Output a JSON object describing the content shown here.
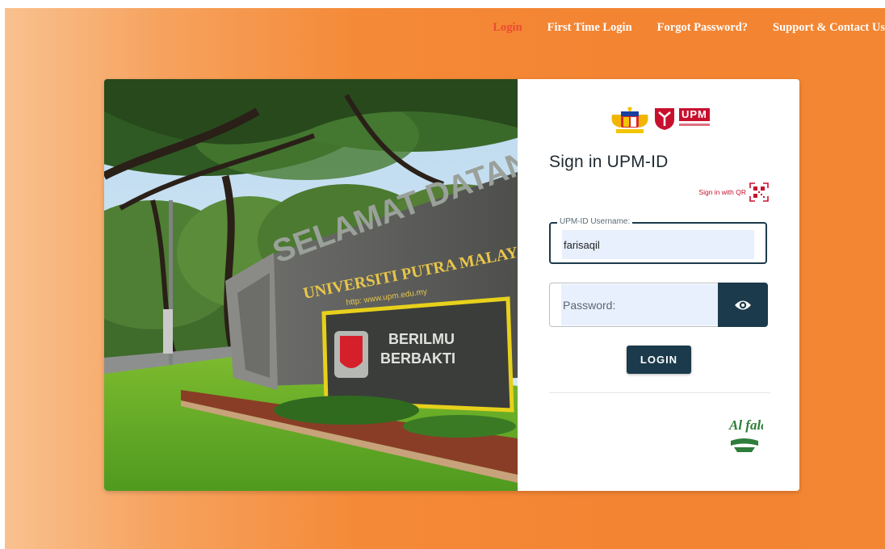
{
  "nav": {
    "items": [
      {
        "label": "Login",
        "active": true
      },
      {
        "label": "First Time Login",
        "active": false
      },
      {
        "label": "Forgot Password?",
        "active": false
      },
      {
        "label": "Support & Contact Us",
        "active": false
      }
    ]
  },
  "hero": {
    "gate_text": "SELAMAT DATANG",
    "university_text": "UNIVERSITI PUTRA MALAYSIA",
    "url_text": "http: www.upm.edu.my",
    "motto_line1": "BERILMU",
    "motto_line2": "BERBAKTI"
  },
  "login": {
    "logo_text": "UPM",
    "title": "Sign in UPM-ID",
    "qr_link_label": "Sign in with QR",
    "username_label": "UPM-ID Username:",
    "username_value": "farisaqil",
    "password_placeholder": "Password:",
    "login_button": "LOGIN",
    "footer_logo_text": "Al falah"
  },
  "colors": {
    "accent": "#f38432",
    "nav_active": "#ec4b33",
    "primary_button": "#1b3a4b",
    "qr_red": "#c8102e"
  }
}
